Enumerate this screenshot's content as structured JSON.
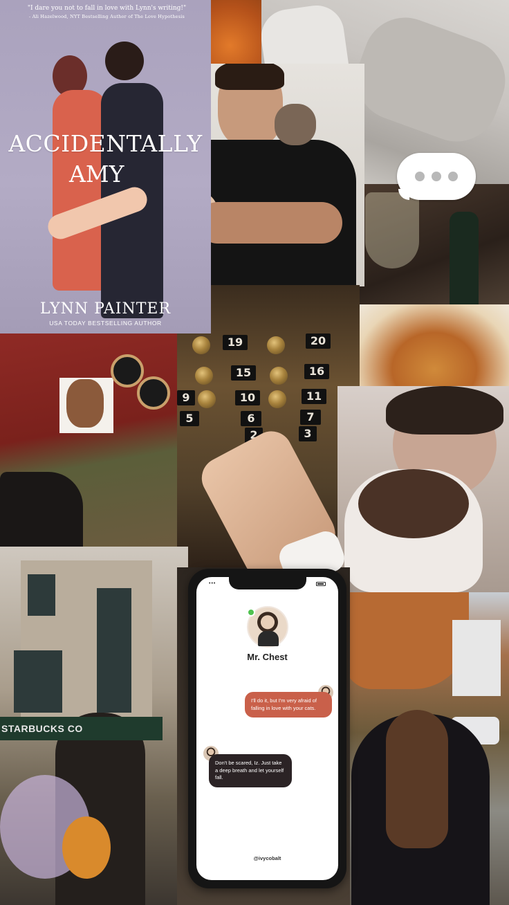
{
  "book": {
    "quote": "\"I dare you not to fall in love with Lynn's writing!\"",
    "quote_attribution": "- Ali Hazelwood, NYT Bestselling Author of The Love Hypothesis",
    "title_line1": "ACCIDENTALLY",
    "title_line2": "AMY",
    "author": "LYNN PAINTER",
    "byline": "USA TODAY BESTSELLING AUTHOR"
  },
  "elevator": {
    "floors": [
      "19",
      "20",
      "15",
      "16",
      "10",
      "11",
      "9",
      "6",
      "7",
      "5",
      "2",
      "3"
    ]
  },
  "street": {
    "sign": "STARBUCKS CO"
  },
  "phone": {
    "status_left": "•••",
    "contact_name": "Mr. Chest",
    "messages": [
      {
        "direction": "outgoing",
        "text": "I'll do it, but I'm very afraid of falling in love with your cats."
      },
      {
        "direction": "incoming",
        "text": "Don't be scared, Iz. Just take a deep breath and let yourself fall."
      }
    ],
    "handle": "@ivycobalt"
  },
  "colors": {
    "outgoing_bubble": "#c9604a",
    "incoming_bubble": "#2b2325",
    "online": "#4fc24f",
    "book_cover": "#aaa2bd"
  }
}
